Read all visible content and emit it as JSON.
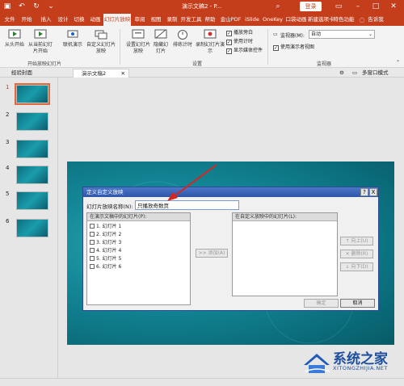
{
  "titlebar": {
    "doc_title": "演示文稿2 - P...",
    "login": "登录",
    "tell_me": "告诉我"
  },
  "tabs": [
    "文件",
    "开始",
    "插入",
    "设计",
    "切换",
    "动画",
    "幻灯片放映",
    "审阅",
    "视图",
    "录制",
    "开发工具",
    "帮助",
    "金山PDF",
    "iSlide",
    "OneKey",
    "口袋动画",
    "新建选项卡",
    "特色功能"
  ],
  "active_tab_index": 6,
  "ribbon": {
    "from_start": "从头开始",
    "from_current": "从当前幻灯片开始",
    "online": "联机演示",
    "custom": "自定义幻灯片放映",
    "group1": "开始放映幻灯片",
    "setup": "设置幻灯片放映",
    "hide": "隐藏幻灯片",
    "rehearse": "排练计时",
    "record": "录制幻灯片演示",
    "chk_narration": "播放旁白",
    "chk_timing": "使用计时",
    "chk_media": "显示媒体控件",
    "group2": "设置",
    "monitor_label": "监视器(M):",
    "monitor_value": "自动",
    "presenter_view": "使用演示者视图",
    "group3": "监视器"
  },
  "doctabs": [
    "经验封面",
    "演示文稿2"
  ],
  "doctab_active": 1,
  "view_mode": "多窗口模式",
  "slides": [
    "1",
    "2",
    "3",
    "4",
    "5",
    "6"
  ],
  "selected_slide": 0,
  "dialog": {
    "title": "定义自定义放映",
    "help": "?",
    "close": "X",
    "name_label": "幻灯片放映名称(N):",
    "name_value": "只播放奇数页",
    "left_header": "在演示文稿中的幻灯片(P):",
    "right_header": "在自定义放映中的幻灯片(L):",
    "items": [
      "1. 幻灯片 1",
      "2. 幻灯片 2",
      "3. 幻灯片 3",
      "4. 幻灯片 4",
      "5. 幻灯片 5",
      "6. 幻灯片 6"
    ],
    "add": ">> 添加(A)",
    "up": "向上(U)",
    "delete": "删除(R)",
    "down": "向下(D)",
    "ok": "确定",
    "cancel": "取消"
  },
  "watermark": {
    "text": "系统之家",
    "url": "XITONGZHIJIA.NET"
  },
  "colors": {
    "accent": "#c43e1c",
    "slide": "#138797",
    "dialog_title": "#2e56a8",
    "arrow": "#d8261f"
  }
}
